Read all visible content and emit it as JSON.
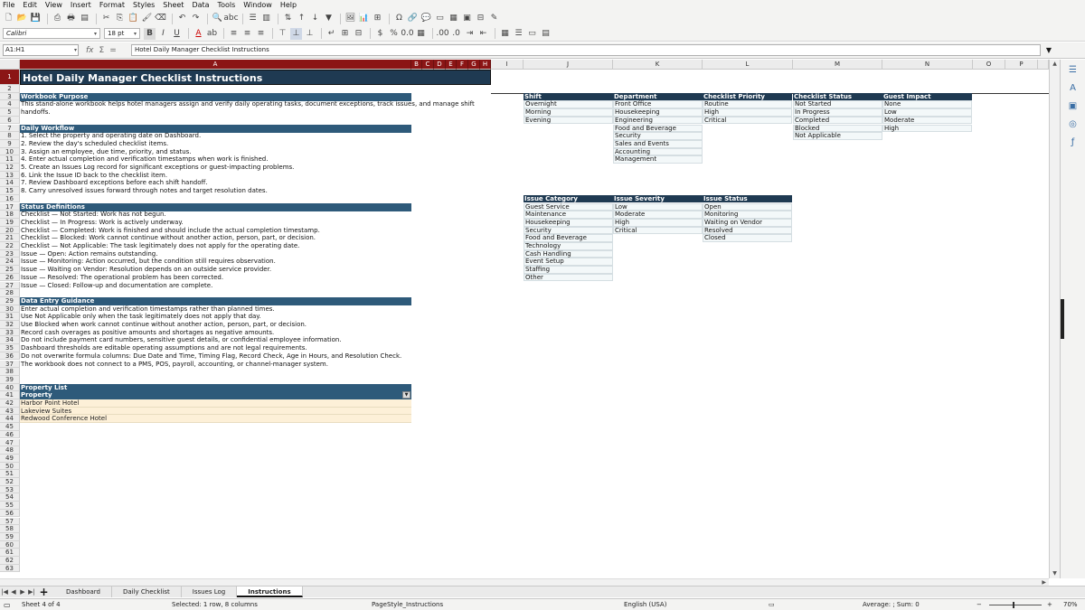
{
  "menu": [
    "File",
    "Edit",
    "View",
    "Insert",
    "Format",
    "Styles",
    "Sheet",
    "Data",
    "Tools",
    "Window",
    "Help"
  ],
  "toolbar": {
    "font_name": "Calibri",
    "font_size": "18 pt"
  },
  "formula_bar": {
    "name_box": "A1:H1",
    "content": "Hotel Daily Manager Checklist Instructions"
  },
  "columns": {
    "selected": [
      "A",
      "B",
      "C",
      "D",
      "E",
      "F",
      "G",
      "H"
    ],
    "others": [
      "I",
      "J",
      "K",
      "L",
      "M",
      "N",
      "O",
      "P"
    ]
  },
  "rows": [
    "1",
    "2",
    "3",
    "4",
    "5",
    "6",
    "7",
    "8",
    "9",
    "10",
    "11",
    "12",
    "13",
    "14",
    "15",
    "16",
    "17",
    "18",
    "19",
    "20",
    "21",
    "22",
    "23",
    "24",
    "25",
    "26",
    "27",
    "28",
    "29",
    "30",
    "31",
    "32",
    "33",
    "34",
    "35",
    "36",
    "37",
    "38",
    "39",
    "40",
    "41",
    "42",
    "43",
    "44",
    "45",
    "46",
    "47",
    "48",
    "49",
    "50",
    "51",
    "52",
    "53",
    "54",
    "55",
    "56",
    "57",
    "58",
    "59",
    "60",
    "61",
    "62",
    "63"
  ],
  "content": {
    "title": "Hotel Daily Manager Checklist Instructions",
    "purpose_header": "Workbook Purpose",
    "purpose_line1": "This stand-alone workbook helps hotel managers assign and verify daily operating tasks, document exceptions, track issues, and manage shift",
    "purpose_line2": "handoffs.",
    "workflow_header": "Daily Workflow",
    "workflow": [
      "1. Select the property and operating date on Dashboard.",
      "2. Review the day's scheduled checklist items.",
      "3. Assign an employee, due time, priority, and status.",
      "4. Enter actual completion and verification timestamps when work is finished.",
      "5. Create an Issues Log record for significant exceptions or guest-impacting problems.",
      "6. Link the Issue ID back to the checklist item.",
      "7. Review Dashboard exceptions before each shift handoff.",
      "8. Carry unresolved issues forward through notes and target resolution dates."
    ],
    "status_header": "Status Definitions",
    "status": [
      "Checklist — Not Started: Work has not begun.",
      "Checklist — In Progress: Work is actively underway.",
      "Checklist — Completed: Work is finished and should include the actual completion timestamp.",
      "Checklist — Blocked: Work cannot continue without another action, person, part, or decision.",
      "Checklist — Not Applicable: The task legitimately does not apply for the operating date.",
      "Issue — Open: Action remains outstanding.",
      "Issue — Monitoring: Action occurred, but the condition still requires observation.",
      "Issue — Waiting on Vendor: Resolution depends on an outside service provider.",
      "Issue — Resolved: The operational problem has been corrected.",
      "Issue — Closed: Follow-up and documentation are complete."
    ],
    "guidance_header": "Data Entry Guidance",
    "guidance": [
      "Enter actual completion and verification timestamps rather than planned times.",
      "Use Not Applicable only when the task legitimately does not apply that day.",
      "Use Blocked when work cannot continue without another action, person, part, or decision.",
      "Record cash overages as positive amounts and shortages as negative amounts.",
      "Do not include payment card numbers, sensitive guest details, or confidential employee information.",
      "Dashboard thresholds are editable operating assumptions and are not legal requirements.",
      "Do not overwrite formula columns: Due Date and Time, Timing Flag, Record Check, Age in Hours, and Resolution Check.",
      "The workbook does not connect to a PMS, POS, payroll, accounting, or channel-manager system."
    ],
    "property_list_header": "Property List",
    "property_col_header": "Property",
    "properties": [
      "Harbor Point Hotel",
      "Lakeview Suites",
      "Redwood Conference Hotel"
    ]
  },
  "lookups": {
    "shift": {
      "header": "Shift",
      "values": [
        "Overnight",
        "Morning",
        "Evening"
      ]
    },
    "department": {
      "header": "Department",
      "values": [
        "Front Office",
        "Housekeeping",
        "Engineering",
        "Food and Beverage",
        "Security",
        "Sales and Events",
        "Accounting",
        "Management"
      ]
    },
    "priority": {
      "header": "Checklist Priority",
      "values": [
        "Routine",
        "High",
        "Critical"
      ]
    },
    "checklist_status": {
      "header": "Checklist Status",
      "values": [
        "Not Started",
        "In Progress",
        "Completed",
        "Blocked",
        "Not Applicable"
      ]
    },
    "guest_impact": {
      "header": "Guest Impact",
      "values": [
        "None",
        "Low",
        "Moderate",
        "High"
      ]
    },
    "issue_category": {
      "header": "Issue Category",
      "values": [
        "Guest Service",
        "Maintenance",
        "Housekeeping",
        "Security",
        "Food and Beverage",
        "Technology",
        "Cash Handling",
        "Event Setup",
        "Staffing",
        "Other"
      ]
    },
    "issue_severity": {
      "header": "Issue Severity",
      "values": [
        "Low",
        "Moderate",
        "High",
        "Critical"
      ]
    },
    "issue_status": {
      "header": "Issue Status",
      "values": [
        "Open",
        "Monitoring",
        "Waiting on Vendor",
        "Resolved",
        "Closed"
      ]
    }
  },
  "tabs": [
    "Dashboard",
    "Daily Checklist",
    "Issues Log",
    "Instructions"
  ],
  "active_tab": "Instructions",
  "status_bar": {
    "sheet": "Sheet 4 of 4",
    "selection": "Selected: 1 row, 8 columns",
    "page_style": "PageStyle_Instructions",
    "language": "English (USA)",
    "summary": "Average: ; Sum: 0",
    "zoom": "70%"
  },
  "colors": {
    "header_dark": "#1f3a52",
    "section": "#2e5a7a",
    "selected_header": "#8b1515",
    "property_fill": "#fdf0d8",
    "lookup_fill": "#f3f8f9"
  }
}
